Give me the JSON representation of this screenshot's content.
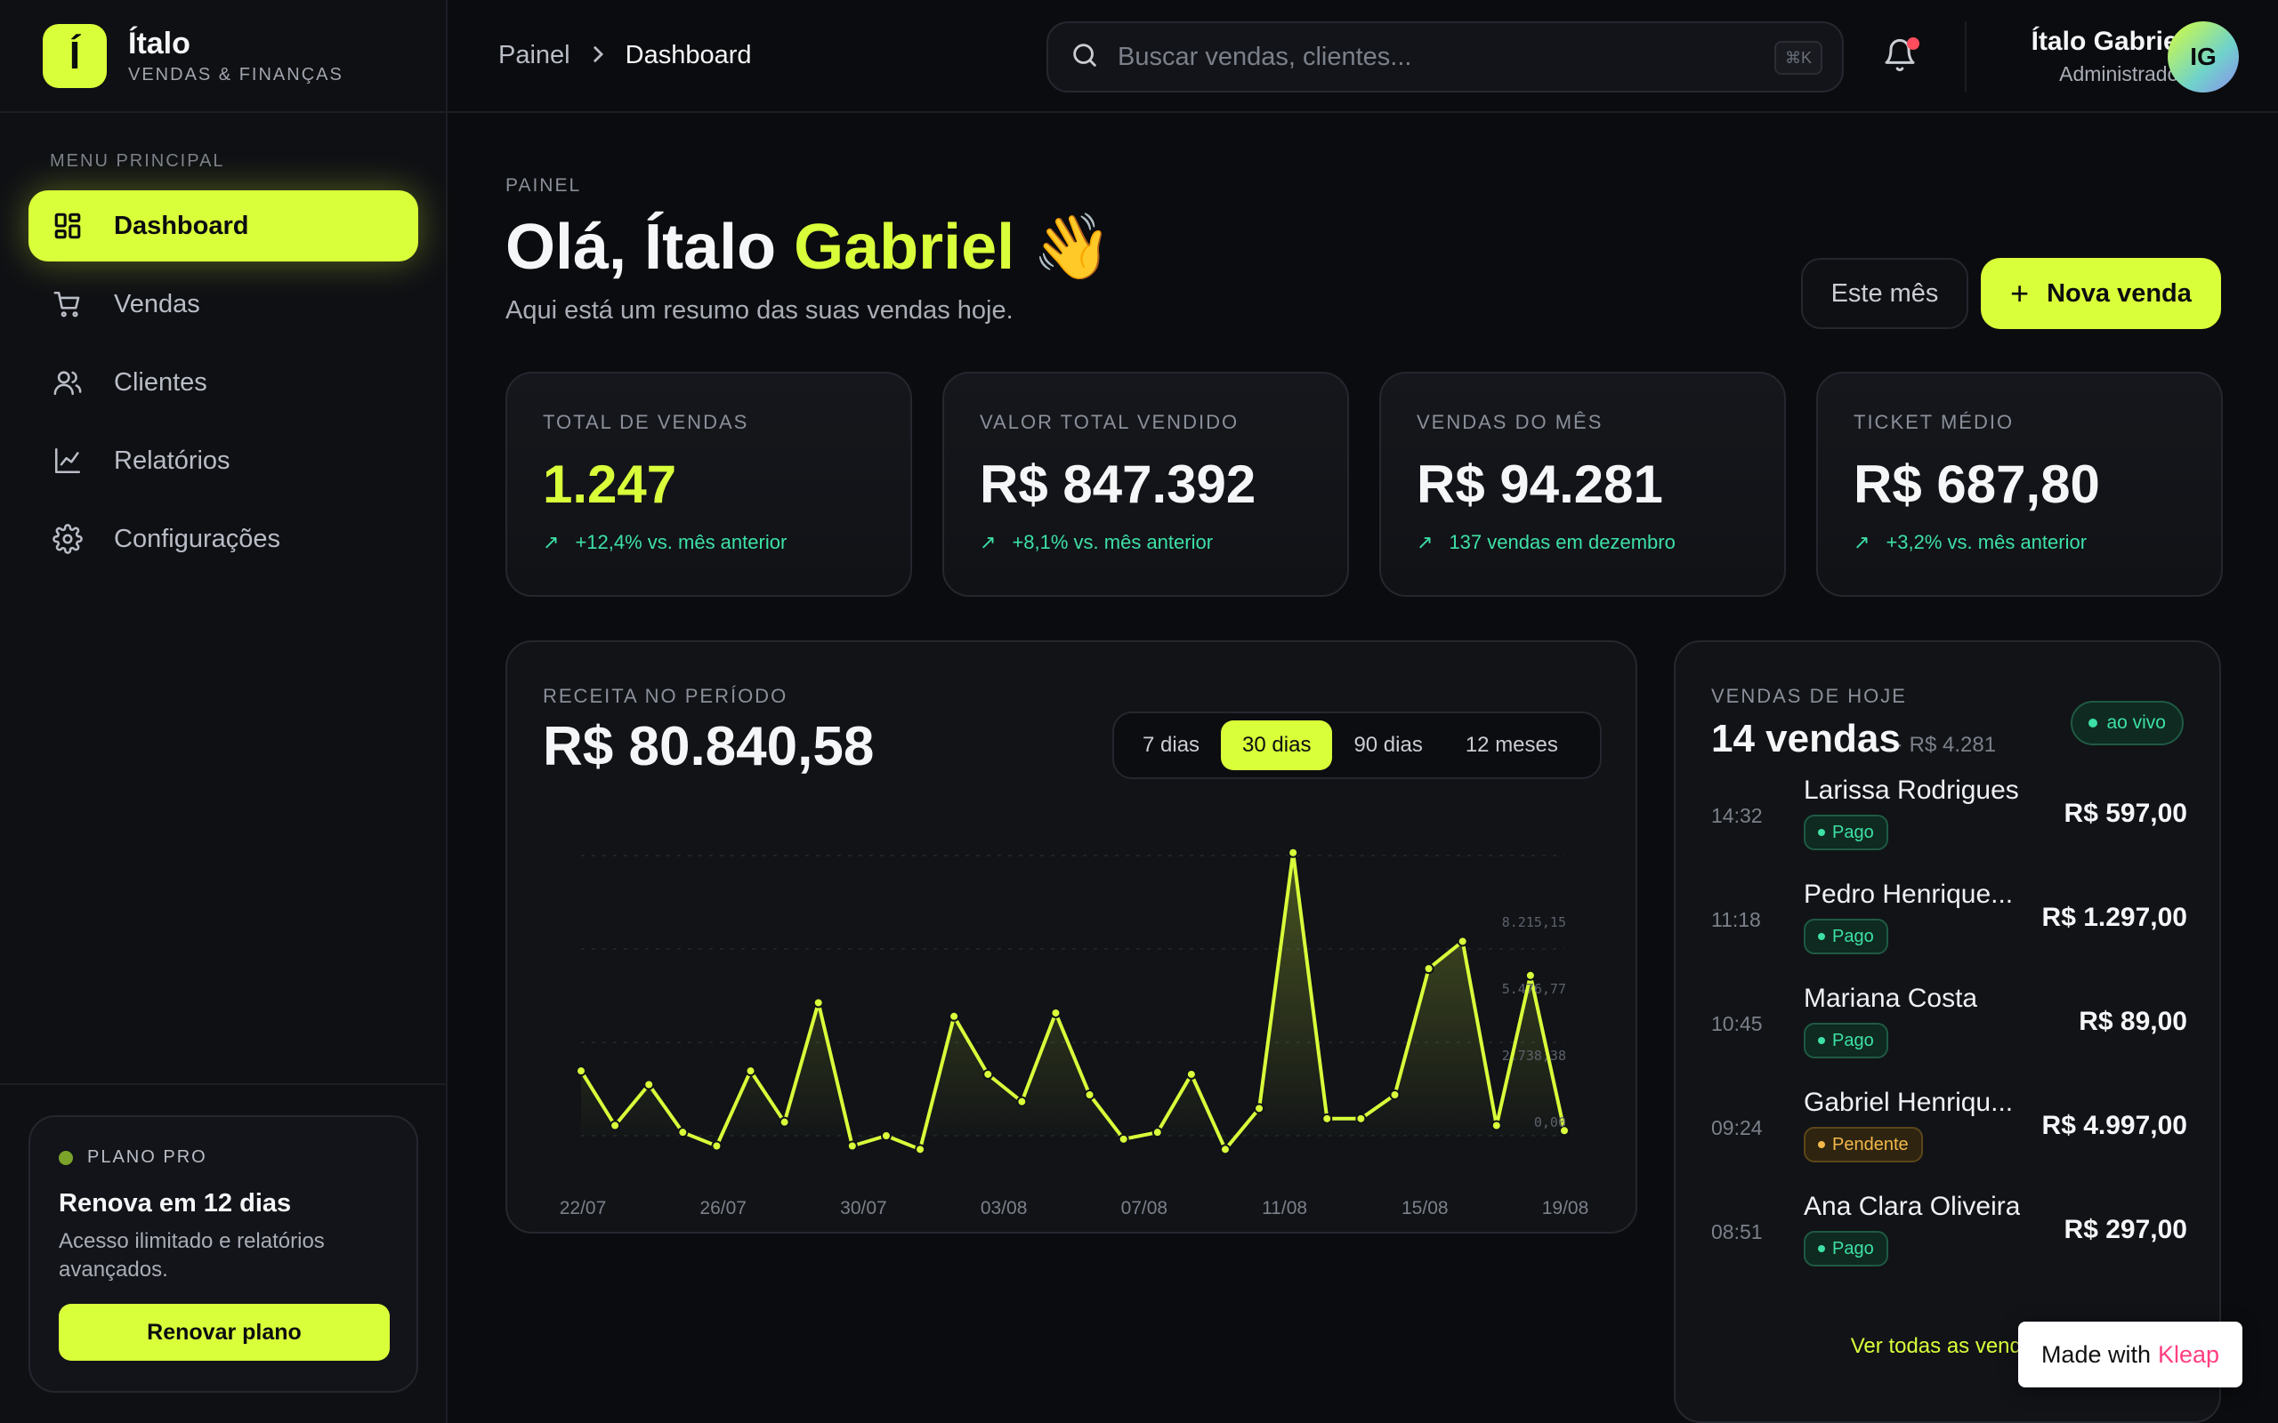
{
  "brand": {
    "logo_letter": "Í",
    "name": "Ítalo",
    "subtitle": "VENDAS & FINANÇAS"
  },
  "sidebar": {
    "heading": "MENU PRINCIPAL",
    "items": [
      {
        "label": "Dashboard",
        "icon": "grid-icon",
        "active": true
      },
      {
        "label": "Vendas",
        "icon": "cart-icon",
        "active": false
      },
      {
        "label": "Clientes",
        "icon": "users-icon",
        "active": false
      },
      {
        "label": "Relatórios",
        "icon": "chart-line-icon",
        "active": false
      },
      {
        "label": "Configurações",
        "icon": "gear-icon",
        "active": false
      }
    ],
    "plan": {
      "tag": "PLANO PRO",
      "title": "Renova em 12 dias",
      "description": "Acesso ilimitado e relatórios avançados.",
      "button": "Renovar plano"
    }
  },
  "topbar": {
    "breadcrumb": {
      "parent": "Painel",
      "current": "Dashboard"
    },
    "search": {
      "placeholder": "Buscar vendas, clientes...",
      "value": "",
      "shortcut": "⌘K"
    },
    "user": {
      "name": "Ítalo Gabriel",
      "role": "Administrador",
      "initials": "IG"
    }
  },
  "header": {
    "eyebrow": "PAINEL",
    "greeting": "Olá, Ítalo ",
    "greeting_highlight": "Gabriel",
    "emoji": "👋",
    "subtitle": "Aqui está um resumo das suas vendas hoje.",
    "period_button": "Este mês",
    "new_sale_button": "Nova venda"
  },
  "kpis": [
    {
      "label": "TOTAL DE VENDAS",
      "value": "1.247",
      "trend": "+12,4% vs. mês anterior",
      "accent": true
    },
    {
      "label": "VALOR TOTAL VENDIDO",
      "value": "R$ 847.392",
      "trend": "+8,1% vs. mês anterior",
      "accent": false
    },
    {
      "label": "VENDAS DO MÊS",
      "value": "R$ 94.281",
      "trend": "137 vendas em dezembro",
      "accent": false
    },
    {
      "label": "TICKET MÉDIO",
      "value": "R$ 687,80",
      "trend": "+3,2% vs. mês anterior",
      "accent": false
    }
  ],
  "revenue": {
    "label": "RECEITA NO PERÍODO",
    "total": "R$ 80.840,58",
    "ranges": [
      "7 dias",
      "30 dias",
      "90 dias",
      "12 meses"
    ],
    "active_range": "30 dias"
  },
  "chart_data": {
    "type": "area",
    "x": [
      "22/07",
      "23/07",
      "24/07",
      "25/07",
      "26/07",
      "27/07",
      "28/07",
      "29/07",
      "30/07",
      "31/07",
      "01/08",
      "02/08",
      "03/08",
      "04/08",
      "05/08",
      "06/08",
      "07/08",
      "08/08",
      "09/08",
      "10/08",
      "11/08",
      "12/08",
      "13/08",
      "14/08",
      "15/08",
      "16/08",
      "17/08",
      "18/08",
      "19/08"
    ],
    "x_ticks": [
      "22/07",
      "26/07",
      "30/07",
      "03/08",
      "07/08",
      "11/08",
      "15/08",
      "19/08"
    ],
    "values": [
      1900,
      300,
      1500,
      100,
      -300,
      1900,
      400,
      3900,
      -300,
      0,
      -400,
      3500,
      1800,
      1000,
      3600,
      1200,
      -100,
      100,
      1800,
      -400,
      800,
      8300,
      500,
      500,
      1200,
      4900,
      5700,
      300,
      4700,
      150
    ],
    "y_ticks": [
      "8.215,15",
      "5.476,77",
      "2.738,38",
      "0,00"
    ],
    "ylim": [
      0,
      8215.15
    ],
    "color": "#d9ff3a"
  },
  "today_sales": {
    "label": "VENDAS DE HOJE",
    "count": "14 vendas",
    "sum": "· R$ 4.281",
    "live": "ao vivo",
    "rows": [
      {
        "time": "14:32",
        "name": "Larissa Rodrigues",
        "status": "Pago",
        "amount": "R$ 597,00"
      },
      {
        "time": "11:18",
        "name": "Pedro Henrique...",
        "status": "Pago",
        "amount": "R$ 1.297,00"
      },
      {
        "time": "10:45",
        "name": "Mariana Costa",
        "status": "Pago",
        "amount": "R$ 89,00"
      },
      {
        "time": "09:24",
        "name": "Gabriel Henriqu...",
        "status": "Pendente",
        "amount": "R$ 4.997,00"
      },
      {
        "time": "08:51",
        "name": "Ana Clara Oliveira",
        "status": "Pago",
        "amount": "R$ 297,00"
      }
    ],
    "see_all": "Ver todas as vendas"
  },
  "footer_badge": {
    "prefix": "Made with",
    "brand": "Kleap"
  },
  "colors": {
    "accent": "#d9ff3a",
    "background": "#0b0c0f",
    "positive": "#3ee0a6",
    "pending": "#f3b84a",
    "notification": "#ff4d5e"
  }
}
